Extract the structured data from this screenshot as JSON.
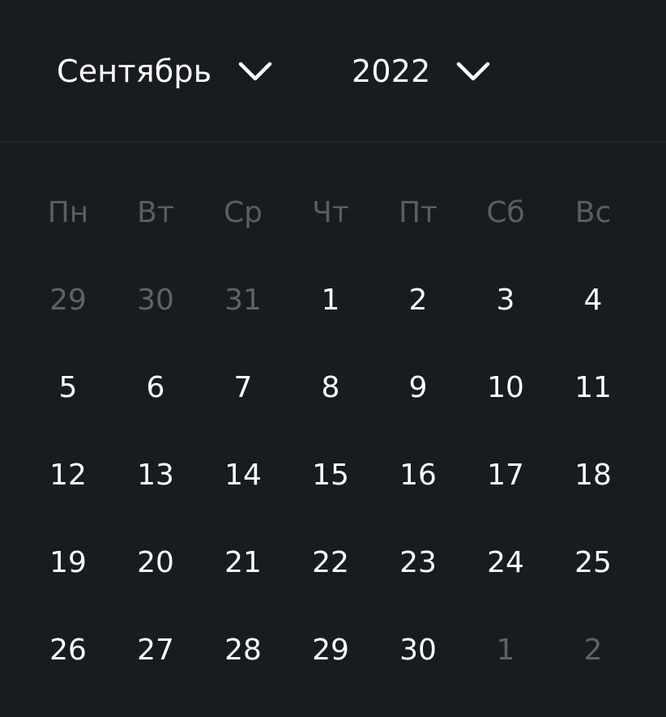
{
  "header": {
    "month_label": "Сентябрь",
    "year_label": "2022",
    "month_chevron_icon": "chevron-down-icon",
    "year_chevron_icon": "chevron-down-icon"
  },
  "colors": {
    "background": "#181b1f",
    "divider": "#24282d",
    "text": "#ffffff",
    "weekday_text": "#5a5e63",
    "muted_day_text": "#5f6368"
  },
  "weekdays": [
    "Пн",
    "Вт",
    "Ср",
    "Чт",
    "Пт",
    "Сб",
    "Вс"
  ],
  "weeks": [
    [
      {
        "label": "29",
        "muted": true
      },
      {
        "label": "30",
        "muted": true
      },
      {
        "label": "31",
        "muted": true
      },
      {
        "label": "1",
        "muted": false
      },
      {
        "label": "2",
        "muted": false
      },
      {
        "label": "3",
        "muted": false
      },
      {
        "label": "4",
        "muted": false
      }
    ],
    [
      {
        "label": "5",
        "muted": false
      },
      {
        "label": "6",
        "muted": false
      },
      {
        "label": "7",
        "muted": false
      },
      {
        "label": "8",
        "muted": false
      },
      {
        "label": "9",
        "muted": false
      },
      {
        "label": "10",
        "muted": false
      },
      {
        "label": "11",
        "muted": false
      }
    ],
    [
      {
        "label": "12",
        "muted": false
      },
      {
        "label": "13",
        "muted": false
      },
      {
        "label": "14",
        "muted": false
      },
      {
        "label": "15",
        "muted": false
      },
      {
        "label": "16",
        "muted": false
      },
      {
        "label": "17",
        "muted": false
      },
      {
        "label": "18",
        "muted": false
      }
    ],
    [
      {
        "label": "19",
        "muted": false
      },
      {
        "label": "20",
        "muted": false
      },
      {
        "label": "21",
        "muted": false
      },
      {
        "label": "22",
        "muted": false
      },
      {
        "label": "23",
        "muted": false
      },
      {
        "label": "24",
        "muted": false
      },
      {
        "label": "25",
        "muted": false
      }
    ],
    [
      {
        "label": "26",
        "muted": false
      },
      {
        "label": "27",
        "muted": false
      },
      {
        "label": "28",
        "muted": false
      },
      {
        "label": "29",
        "muted": false
      },
      {
        "label": "30",
        "muted": false
      },
      {
        "label": "1",
        "muted": true
      },
      {
        "label": "2",
        "muted": true
      }
    ]
  ]
}
